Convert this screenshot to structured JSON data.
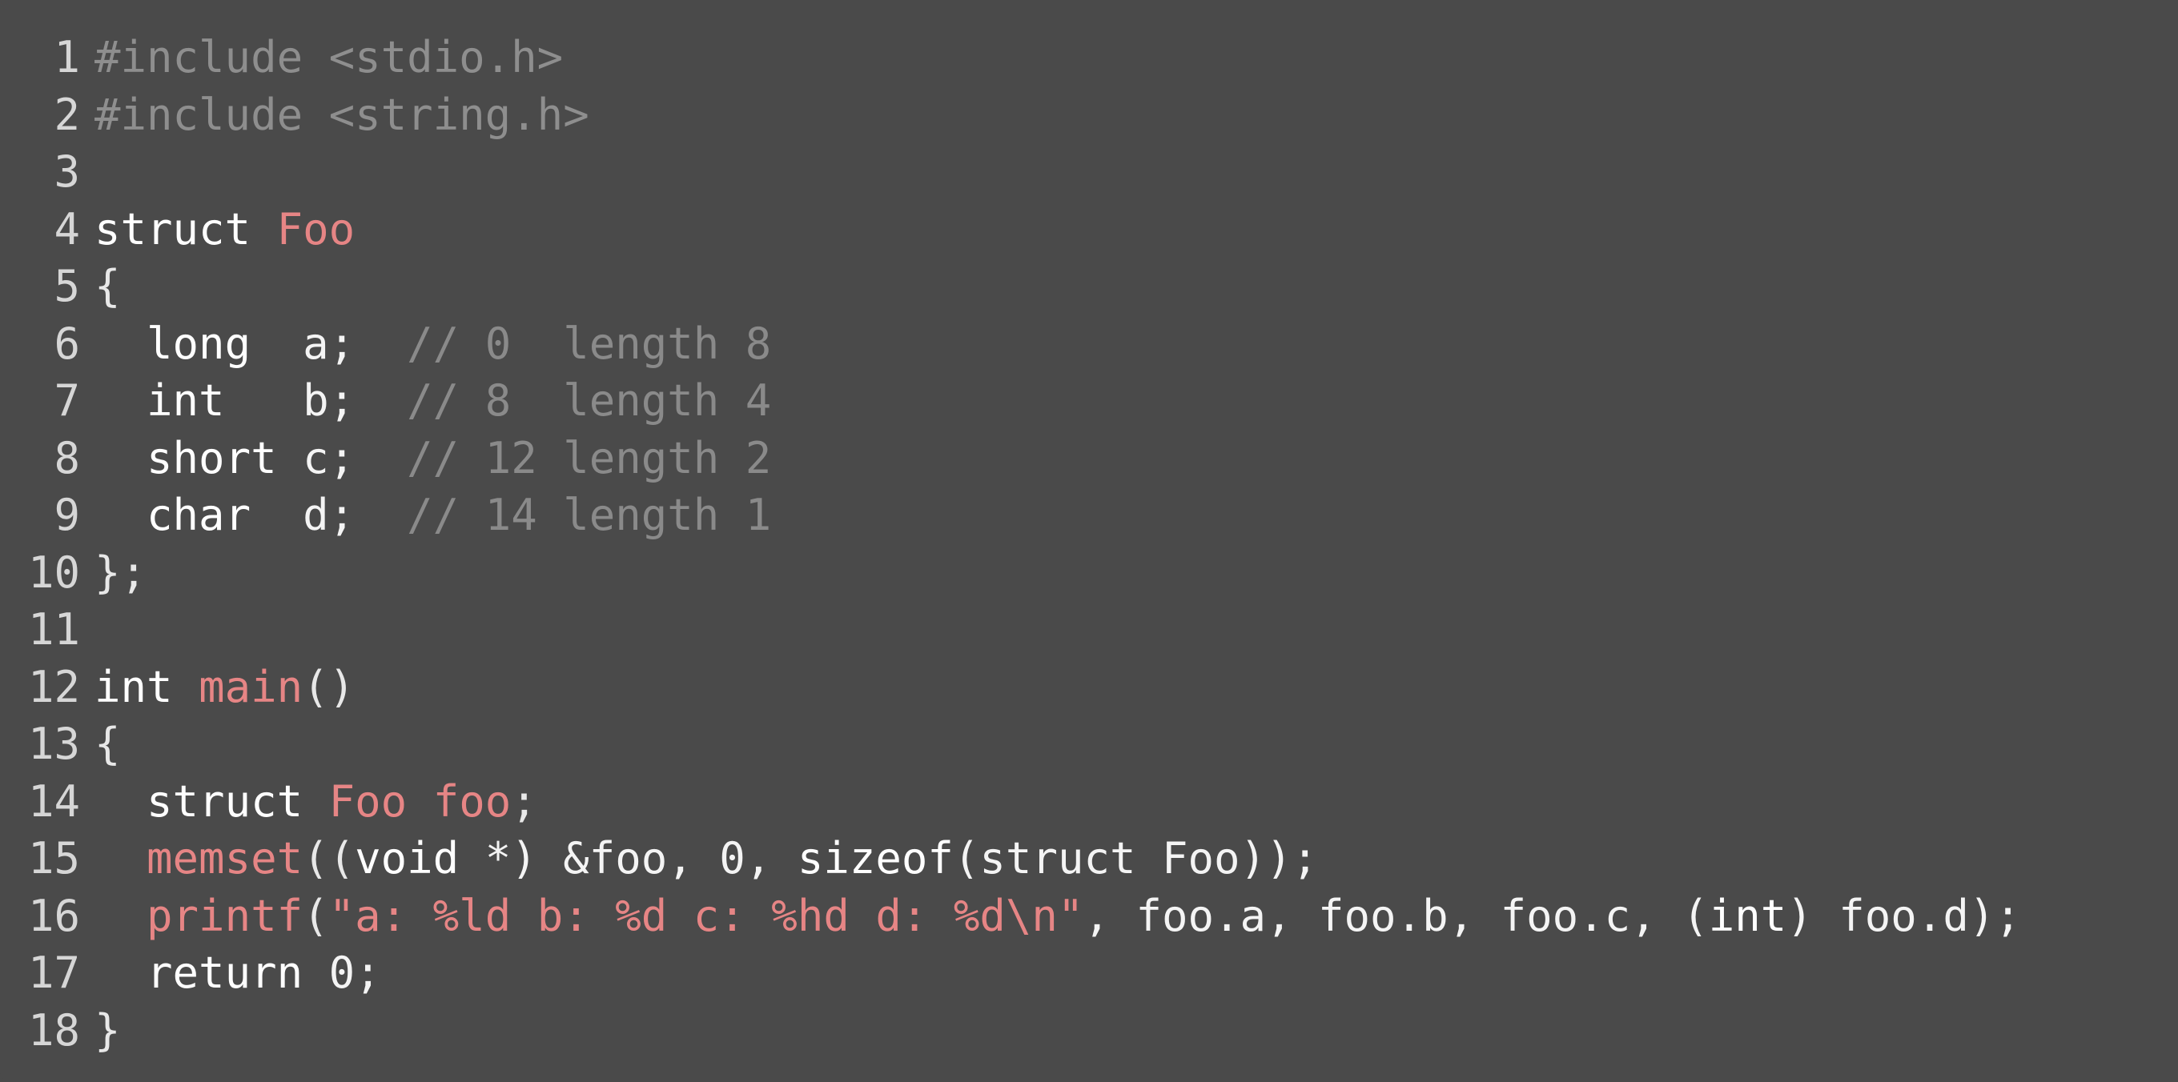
{
  "editor": {
    "language": "c",
    "colors": {
      "background": "#4a4a4a",
      "line_number": "#d6d6d6",
      "text": "#f4f4f4",
      "keyword": "#ffffff",
      "function_and_string": "#e68585",
      "preprocessor": "#8e8e8e",
      "comment": "#8a8a8a"
    },
    "lines": [
      {
        "number": "1",
        "tokens": [
          {
            "t": "#include <stdio.h>",
            "k": "pre"
          }
        ]
      },
      {
        "number": "2",
        "tokens": [
          {
            "t": "#include <string.h>",
            "k": "pre"
          }
        ]
      },
      {
        "number": "3",
        "tokens": []
      },
      {
        "number": "4",
        "tokens": [
          {
            "t": "struct",
            "k": "kw"
          },
          {
            "t": " ",
            "k": "plain"
          },
          {
            "t": "Foo",
            "k": "name"
          }
        ]
      },
      {
        "number": "5",
        "tokens": [
          {
            "t": "{",
            "k": "punct"
          }
        ]
      },
      {
        "number": "6",
        "tokens": [
          {
            "t": "  ",
            "k": "plain"
          },
          {
            "t": "long",
            "k": "type"
          },
          {
            "t": "  a;  ",
            "k": "plain"
          },
          {
            "t": "// 0  length 8",
            "k": "cmt"
          }
        ]
      },
      {
        "number": "7",
        "tokens": [
          {
            "t": "  ",
            "k": "plain"
          },
          {
            "t": "int",
            "k": "type"
          },
          {
            "t": "   b;  ",
            "k": "plain"
          },
          {
            "t": "// 8  length 4",
            "k": "cmt"
          }
        ]
      },
      {
        "number": "8",
        "tokens": [
          {
            "t": "  ",
            "k": "plain"
          },
          {
            "t": "short",
            "k": "type"
          },
          {
            "t": " c;  ",
            "k": "plain"
          },
          {
            "t": "// 12 length 2",
            "k": "cmt"
          }
        ]
      },
      {
        "number": "9",
        "tokens": [
          {
            "t": "  ",
            "k": "plain"
          },
          {
            "t": "char",
            "k": "type"
          },
          {
            "t": "  d;  ",
            "k": "plain"
          },
          {
            "t": "// 14 length 1",
            "k": "cmt"
          }
        ]
      },
      {
        "number": "10",
        "tokens": [
          {
            "t": "};",
            "k": "punct"
          }
        ]
      },
      {
        "number": "11",
        "tokens": []
      },
      {
        "number": "12",
        "tokens": [
          {
            "t": "int",
            "k": "type"
          },
          {
            "t": " ",
            "k": "plain"
          },
          {
            "t": "main",
            "k": "fn"
          },
          {
            "t": "()",
            "k": "punct"
          }
        ]
      },
      {
        "number": "13",
        "tokens": [
          {
            "t": "{",
            "k": "punct"
          }
        ]
      },
      {
        "number": "14",
        "tokens": [
          {
            "t": "  ",
            "k": "plain"
          },
          {
            "t": "struct",
            "k": "kw"
          },
          {
            "t": " ",
            "k": "plain"
          },
          {
            "t": "Foo",
            "k": "name"
          },
          {
            "t": " ",
            "k": "plain"
          },
          {
            "t": "foo",
            "k": "name"
          },
          {
            "t": ";",
            "k": "punct"
          }
        ]
      },
      {
        "number": "15",
        "tokens": [
          {
            "t": "  ",
            "k": "plain"
          },
          {
            "t": "memset",
            "k": "fn"
          },
          {
            "t": "((",
            "k": "punct"
          },
          {
            "t": "void",
            "k": "type"
          },
          {
            "t": " *) &foo, 0, ",
            "k": "plain"
          },
          {
            "t": "sizeof",
            "k": "kw"
          },
          {
            "t": "(struct Foo));",
            "k": "plain"
          }
        ]
      },
      {
        "number": "16",
        "tokens": [
          {
            "t": "  ",
            "k": "plain"
          },
          {
            "t": "printf",
            "k": "fn"
          },
          {
            "t": "(",
            "k": "punct"
          },
          {
            "t": "\"a: %ld b: %d c: %hd d: %d\\n\"",
            "k": "str"
          },
          {
            "t": ", foo.a, foo.b, foo.c, (",
            "k": "plain"
          },
          {
            "t": "int",
            "k": "type"
          },
          {
            "t": ") foo.d);",
            "k": "plain"
          }
        ]
      },
      {
        "number": "17",
        "tokens": [
          {
            "t": "  ",
            "k": "plain"
          },
          {
            "t": "return",
            "k": "kw"
          },
          {
            "t": " 0;",
            "k": "plain"
          }
        ]
      },
      {
        "number": "18",
        "tokens": [
          {
            "t": "}",
            "k": "punct"
          }
        ]
      }
    ]
  }
}
